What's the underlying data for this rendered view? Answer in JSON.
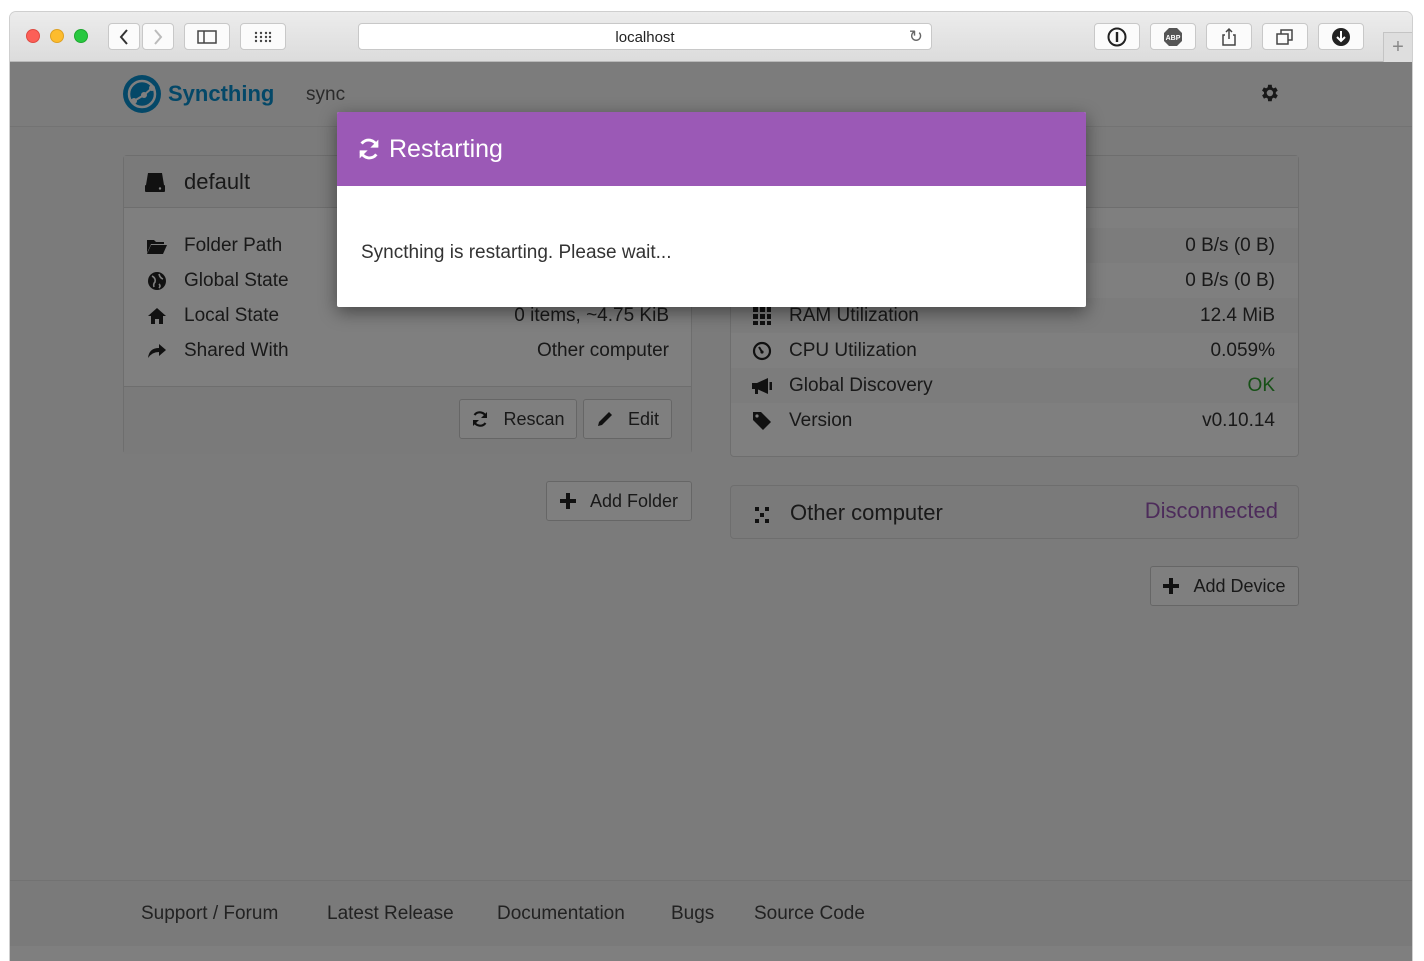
{
  "browser": {
    "url": "localhost"
  },
  "navbar": {
    "brand": "Syncthing",
    "hostname": "sync"
  },
  "folder": {
    "name": "default",
    "rows": [
      {
        "label": "Folder Path",
        "value": "",
        "icon": "folder-open-icon"
      },
      {
        "label": "Global State",
        "value": "",
        "icon": "globe-icon"
      },
      {
        "label": "Local State",
        "value": "0 items, ~4.75 KiB",
        "icon": "home-icon"
      },
      {
        "label": "Shared With",
        "value": "Other computer",
        "icon": "share-arrow-icon"
      }
    ],
    "rescan_label": "Rescan",
    "edit_label": "Edit",
    "add_folder_label": "Add Folder"
  },
  "this_device": {
    "rows": [
      {
        "label": "",
        "value": "0 B/s (0 B)"
      },
      {
        "label": "",
        "value": "0 B/s (0 B)"
      },
      {
        "label": "RAM Utilization",
        "value": "12.4 MiB",
        "icon": "th-grid-icon"
      },
      {
        "label": "CPU Utilization",
        "value": "0.059%",
        "icon": "dashboard-icon"
      },
      {
        "label": "Global Discovery",
        "value": "OK",
        "icon": "bullhorn-icon"
      },
      {
        "label": "Version",
        "value": "v0.10.14",
        "icon": "tag-icon"
      }
    ]
  },
  "other_device": {
    "name": "Other computer",
    "status": "Disconnected",
    "add_device_label": "Add Device"
  },
  "footer": {
    "links": [
      "Support / Forum",
      "Latest Release",
      "Documentation",
      "Bugs",
      "Source Code"
    ]
  },
  "modal": {
    "title": "Restarting",
    "body": "Syncthing is restarting. Please wait..."
  },
  "colors": {
    "brand": "#0891d1",
    "modal_header": "#9b59b6",
    "ok": "#2ca02c",
    "disconnected": "#9b59b6"
  }
}
